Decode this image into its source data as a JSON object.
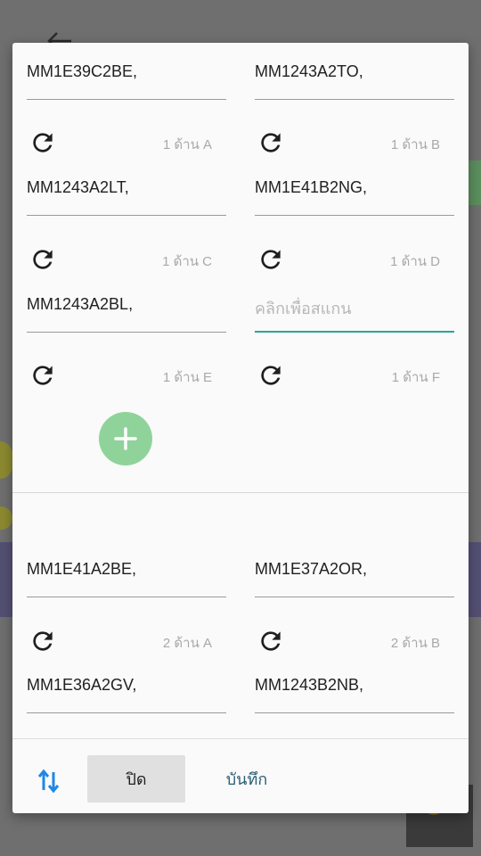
{
  "background": {
    "back_icon": "arrow-left-icon"
  },
  "dialog": {
    "group1": {
      "fields": [
        {
          "value": "MM1E39C2BE,",
          "placeholder": ""
        },
        {
          "value": "MM1243A2TO,",
          "placeholder": ""
        },
        {
          "value": "MM1243A2LT,",
          "placeholder": ""
        },
        {
          "value": "MM1E41B2NG,",
          "placeholder": ""
        },
        {
          "value": "MM1243A2BL,",
          "placeholder": ""
        },
        {
          "value": "",
          "placeholder": "คลิกเพื่อสแกน"
        }
      ],
      "side_labels": [
        "1 ด้าน A",
        "1 ด้าน B",
        "1 ด้าน C",
        "1 ด้าน D",
        "1 ด้าน E",
        "1 ด้าน F"
      ]
    },
    "group2": {
      "fields": [
        {
          "value": "MM1E41A2BE,"
        },
        {
          "value": "MM1E37A2OR,"
        },
        {
          "value": "MM1E36A2GV,"
        },
        {
          "value": "MM1243B2NB,"
        }
      ],
      "side_labels": [
        "2 ด้าน A",
        "2 ด้าน B"
      ]
    },
    "footer": {
      "close_label": "ปิด",
      "save_label": "บันทึก"
    }
  },
  "icons": {
    "refresh": "refresh-icon",
    "add": "add-icon",
    "swap": "swap-vertical-icon"
  },
  "colors": {
    "active_underline": "#26a69a",
    "fab": "#8fd39b",
    "swap_icon": "#1e88e5",
    "save_text": "#2a6075"
  }
}
